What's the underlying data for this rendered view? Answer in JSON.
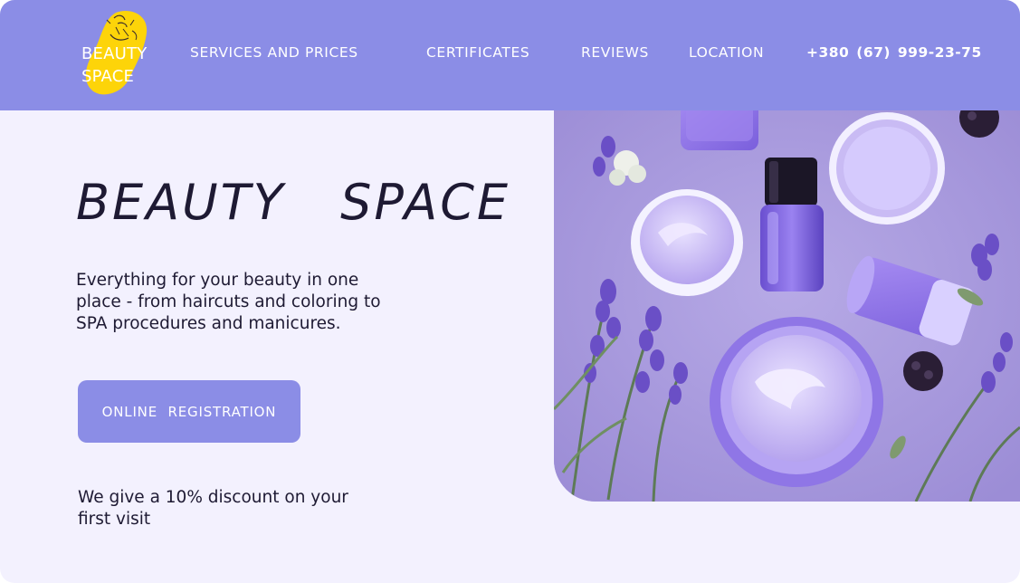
{
  "header": {
    "logo": {
      "line1": "BEAUTY",
      "line2": "SPACE"
    },
    "nav": [
      {
        "label": "SERVICES AND PRICES"
      },
      {
        "label": "CERTIFICATES"
      },
      {
        "label": "REVIEWS"
      },
      {
        "label": "LOCATION"
      }
    ],
    "phone": "+380 (67)  999-23-75"
  },
  "hero": {
    "title": "BEAUTY   SPACE",
    "description": "Everything for your beauty in one place - from haircuts and coloring to SPA procedures and manicures.",
    "cta_label": "ONLINE   REGISTRATION",
    "discount": "We give a 10% discount on your first visit"
  },
  "colors": {
    "header_bg": "#8b8de6",
    "page_bg": "#f3f1fe",
    "logo_blob": "#fdd409",
    "text_dark": "#1e1a33",
    "lavender": "#a99bdc"
  },
  "icons": {
    "logo_blob": "yellow-blob-face-icon"
  }
}
